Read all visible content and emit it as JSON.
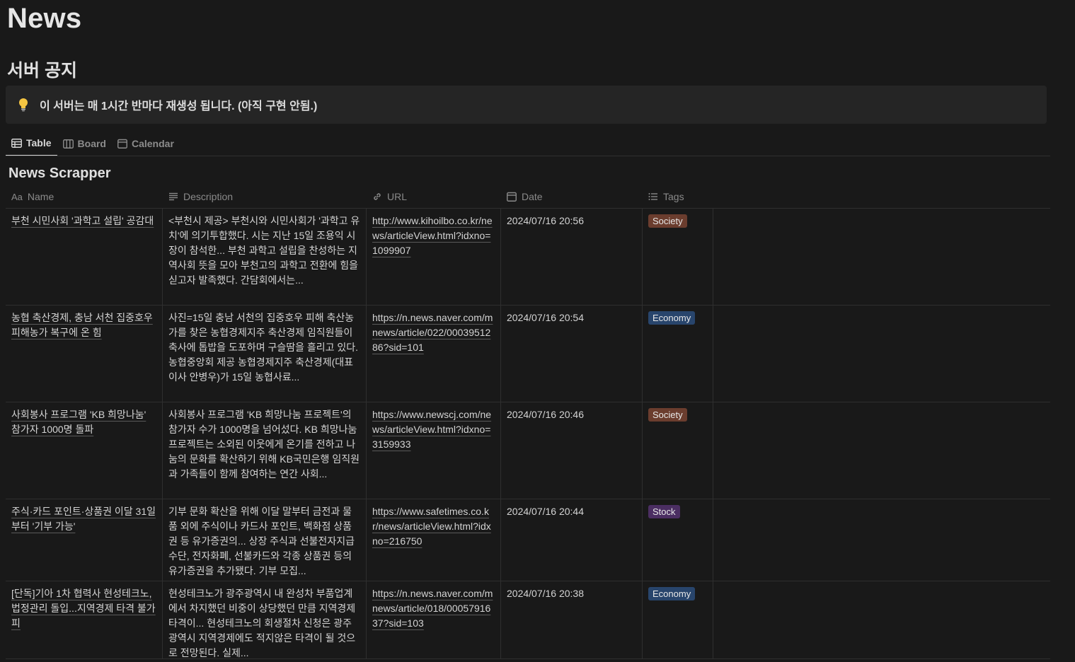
{
  "page": {
    "title": "News"
  },
  "section": {
    "heading": "서버 공지"
  },
  "callout": {
    "icon": "lightbulb-icon",
    "text": "이 서버는 매 1시간 반마다 재생성 됩니다. (아직 구현 안됨.)"
  },
  "tabs": [
    {
      "label": "Table",
      "icon": "table-icon",
      "active": true
    },
    {
      "label": "Board",
      "icon": "board-icon",
      "active": false
    },
    {
      "label": "Calendar",
      "icon": "calendar-icon",
      "active": false
    }
  ],
  "database": {
    "title": "News Scrapper",
    "columns": [
      {
        "label": "Name",
        "icon": "text-aa-icon"
      },
      {
        "label": "Description",
        "icon": "lines-icon"
      },
      {
        "label": "URL",
        "icon": "link-icon"
      },
      {
        "label": "Date",
        "icon": "calendar-icon"
      },
      {
        "label": "Tags",
        "icon": "list-icon"
      }
    ],
    "rows": [
      {
        "name": "부천 시민사회 '과학고 설립' 공감대",
        "description": "<부천시 제공> 부천시와 시민사회가 '과학고 유치'에 의기투합했다. 시는 지난 15일 조용익 시장이 참석한... 부천 과학고 설립을 찬성하는 지역사회 뜻을 모아 부천고의 과학고 전환에 힘을 싣고자 발족했다. 간담회에서는...",
        "url": "http://www.kihoilbo.co.kr/news/articleView.html?idxno=1099907",
        "date": "2024/07/16 20:56",
        "tag": "Society"
      },
      {
        "name": "농협 축산경제, 충남 서천 집중호우 피해농가 복구에 온 힘",
        "description": "사진=15일 충남 서천의 집중호우 피해 축산농가를 찾은 농협경제지주 축산경제 임직원들이 축사에 톱밥을 도포하며 구슬땀을 흘리고 있다. 농협중앙회 제공 농협경제지주 축산경제(대표이사 안병우)가 15일 농협사료...",
        "url": "https://n.news.naver.com/mnews/article/022/0003951286?sid=101",
        "date": "2024/07/16 20:54",
        "tag": "Economy"
      },
      {
        "name": "사회봉사 프로그램 'KB 희망나눔' 참가자 1000명 돌파",
        "description": "사회봉사 프로그램 'KB 희망나눔 프로젝트'의 참가자 수가 1000명을 넘어섰다. KB 희망나눔 프로젝트는 소외된 이웃에게 온기를 전하고 나눔의 문화를 확산하기 위해 KB국민은행 임직원과 가족들이 함께 참여하는 연간 사회...",
        "url": "https://www.newscj.com/news/articleView.html?idxno=3159933",
        "date": "2024/07/16 20:46",
        "tag": "Society"
      },
      {
        "name": "주식·카드 포인트·상품권 이달 31일부터 '기부 가능'",
        "description": "기부 문화 확산을 위해 이달 말부터 금전과 물품 외에 주식이나 카드사 포인트, 백화점 상품권 등 유가증권의... 상장 주식과 선불전자지급수단, 전자화폐, 선불카드와 각종 상품권 등의 유가증권을 추가됐다. 기부 모집...",
        "url": "https://www.safetimes.co.kr/news/articleView.html?idxno=216750",
        "date": "2024/07/16 20:44",
        "tag": "Stock"
      },
      {
        "name": "[단독]기아 1차 협력사 현성테크노, 법정관리 돌입...지역경제 타격 불가피",
        "description": "현성테크노가 광주광역시 내 완성차 부품업계에서 차지했던 비중이 상당했던 만큼 지역경제 타격이... 현성테크노의 회생절차 신청은 광주광역시 지역경제에도 적지않은 타격이 될 것으로 전망된다. 실제...",
        "url": "https://n.news.naver.com/mnews/article/018/0005791637?sid=103",
        "date": "2024/07/16 20:38",
        "tag": "Economy"
      }
    ]
  },
  "tag_colors": {
    "Society": "#6b3d2e",
    "Economy": "#28456c",
    "Stock": "#4b2e62"
  }
}
